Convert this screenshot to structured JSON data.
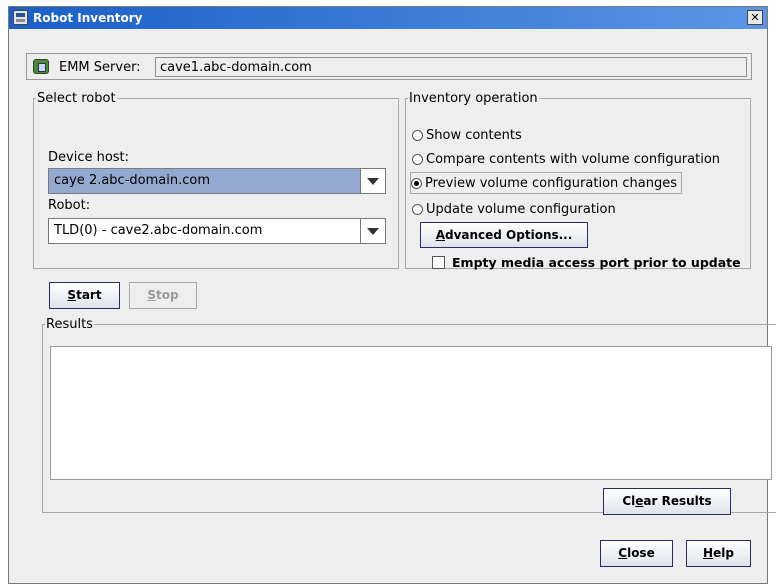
{
  "window": {
    "title": "Robot Inventory"
  },
  "emm": {
    "label": "EMM Server:",
    "value": "cave1.abc-domain.com"
  },
  "select_robot": {
    "legend": "Select robot",
    "device_host_label": "Device host:",
    "device_host_value": "caye 2.abc-domain.com",
    "robot_label": "Robot:",
    "robot_value": "TLD(0) - cave2.abc-domain.com"
  },
  "inventory": {
    "legend": "Inventory operation",
    "options": [
      {
        "label": "Show contents",
        "checked": false
      },
      {
        "label": "Compare contents with volume configuration",
        "checked": false
      },
      {
        "label": "Preview volume configuration changes",
        "checked": true
      },
      {
        "label": "Update volume configuration",
        "checked": false
      }
    ],
    "advanced_btn": {
      "mnemonic": "A",
      "rest": "dvanced Options..."
    },
    "empty_port_label": "Empty media access port prior to update"
  },
  "actions": {
    "start": {
      "mnemonic": "S",
      "rest": "tart"
    },
    "stop": {
      "mnemonic": "S",
      "rest": "top"
    }
  },
  "results": {
    "legend": "Results",
    "clear": {
      "pre": "Cl",
      "mnemonic": "e",
      "rest": "ar Results"
    }
  },
  "footer": {
    "close": {
      "mnemonic": "C",
      "rest": "lose"
    },
    "help": {
      "mnemonic": "H",
      "rest": "elp"
    }
  }
}
